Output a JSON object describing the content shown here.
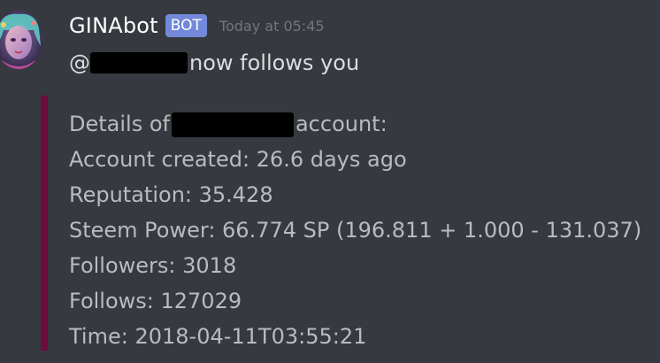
{
  "message": {
    "author": "GINAbot",
    "tag": "BOT",
    "timestamp": "Today at 05:45",
    "mention_prefix": "@",
    "content_suffix": "now follows you"
  },
  "embed": {
    "details_prefix": "Details of",
    "details_suffix": "account:",
    "lines": [
      "Account created: 26.6 days ago",
      "Reputation: 35.428",
      "Steem Power: 66.774 SP (196.811 + 1.000 - 131.037)",
      "Followers: 3018",
      "Follows: 127029",
      "Time: 2018-04-11T03:55:21"
    ],
    "accent_color": "#6e0a3c"
  },
  "colors": {
    "background": "#36393f",
    "bot_tag": "#7289da",
    "username": "#ffffff",
    "text": "#dcddde",
    "embed_text": "#b9bbbe",
    "timestamp": "#72767d"
  }
}
